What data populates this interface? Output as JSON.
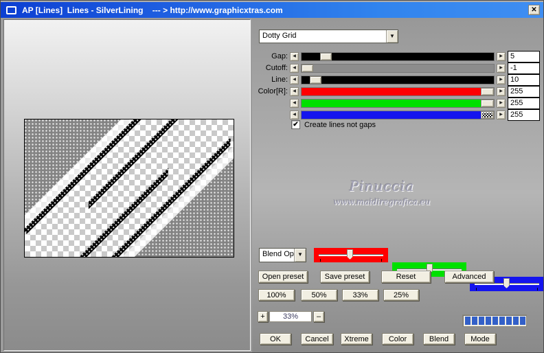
{
  "window": {
    "title": "AP [Lines]  Lines - SilverLining    --- > http://www.graphicxtras.com",
    "close_glyph": "✕"
  },
  "pattern_select": {
    "value": "Dotty Grid"
  },
  "sliders": [
    {
      "label": "Gap:",
      "value": "5"
    },
    {
      "label": "Cutoff:",
      "value": "-1"
    },
    {
      "label": "Line:",
      "value": "10"
    },
    {
      "label": "Color[R]:",
      "value": "255"
    },
    {
      "label": "",
      "value": "255"
    },
    {
      "label": "",
      "value": "255"
    }
  ],
  "checkbox": {
    "label": "Create lines not gaps",
    "checked": true
  },
  "watermark": {
    "line1": "Pinuccia",
    "line2": "www.maidiregrafica.eu"
  },
  "blend_select": {
    "value": "Blend Options"
  },
  "preset_buttons": [
    "Open preset",
    "Save preset",
    "Reset",
    "Advanced"
  ],
  "zoom_buttons": [
    "100%",
    "50%",
    "33%",
    "25%"
  ],
  "zoom_control": {
    "plus": "+",
    "value": "33%",
    "minus": "–"
  },
  "progress": {
    "segments": 9
  },
  "action_buttons": [
    "OK",
    "Cancel",
    "Xtreme",
    "Color",
    "Blend",
    "Mode"
  ],
  "colors": {
    "titlebar_left": "#0c3fd2",
    "titlebar_right": "#3f8ef2",
    "gap_track": "#000000",
    "cutoff_track": "#8c8c8c",
    "line_track": "#000000",
    "red_track": "#ff0000",
    "green_track": "#00e000",
    "blue_track": "#1414ee",
    "progress_segment": "#3360c8",
    "button_face": "#f2efe2"
  }
}
